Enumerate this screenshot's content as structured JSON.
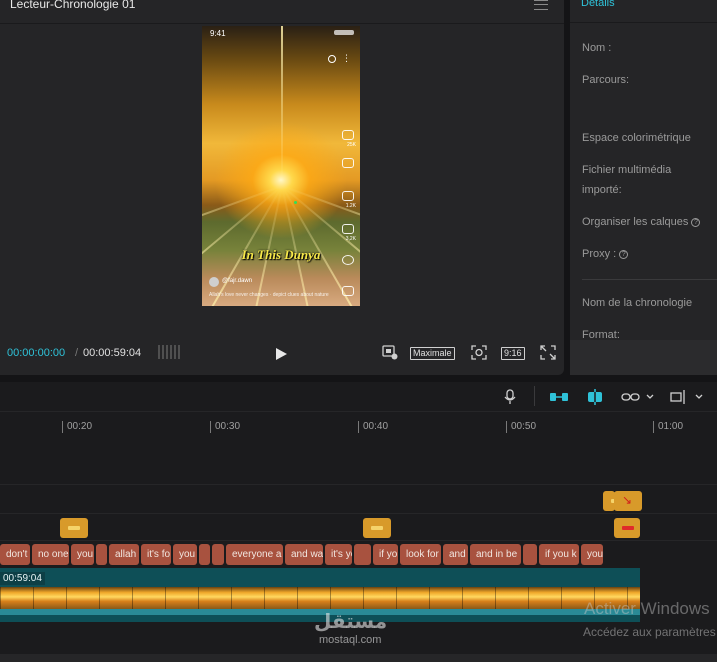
{
  "player": {
    "title": "Lecteur-Chronologie 01",
    "current_time": "00:00:00:00",
    "separator": "/",
    "total_time": "00:00:59:04",
    "quality_label": "Maximale",
    "ratio_label": "9:16",
    "preview": {
      "clock": "9:41",
      "caption": "In This Dunya",
      "author": "@fajr.dawn",
      "description": "Allah's love never changes · depict clues about nature",
      "side_counts": [
        "25K",
        "",
        "1.2K",
        "3,2K",
        ""
      ]
    }
  },
  "details": {
    "title": "Détails",
    "name_label": "Nom :",
    "path_label": "Parcours:",
    "colorspace_label": "Espace colorimétrique",
    "imported_label_1": "Fichier multimédia",
    "imported_label_2": "importé:",
    "layers_label": "Organiser les calques",
    "proxy_label": "Proxy :",
    "timeline_name_label": "Nom de la chronologie",
    "format_label": "Format:"
  },
  "timeline": {
    "ruler": [
      "00:20",
      "00:30",
      "00:40",
      "00:50",
      "01:00"
    ],
    "subtitles": [
      "don't",
      "no one",
      "you",
      "",
      "allah",
      "it's fo",
      "you",
      "",
      "",
      "everyone a",
      "and wa",
      "it's yo",
      "",
      "if yo",
      "look for",
      "and i",
      "and in be",
      "",
      "if you k",
      "you"
    ],
    "video_label": "00:59:04"
  },
  "overlay": {
    "activate_title": "Activer Windows",
    "activate_sub": "Accédez aux paramètres",
    "logo": "مستقل",
    "logo_url": "mostaql.com"
  },
  "colors": {
    "accent": "#2fc2d8",
    "subtitle_clip": "#a8523f",
    "marker": "#d89a2a",
    "video_track": "#0e4f57"
  }
}
